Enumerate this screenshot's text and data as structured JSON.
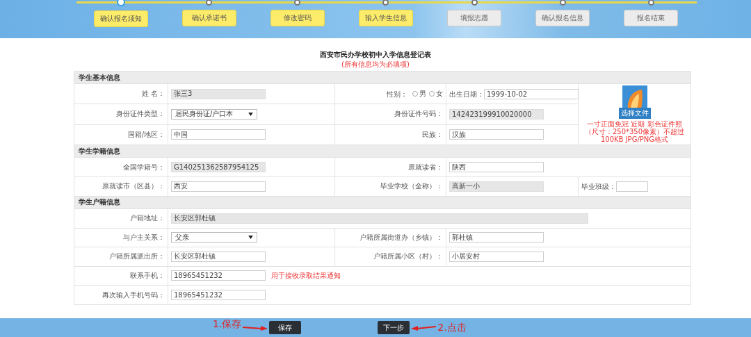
{
  "steps": [
    {
      "label": "确认报名须知",
      "done": true,
      "selected": true
    },
    {
      "label": "确认承诺书",
      "done": true,
      "selected": false
    },
    {
      "label": "修改密码",
      "done": true,
      "selected": false
    },
    {
      "label": "输入学生信息",
      "done": true,
      "selected": false
    },
    {
      "label": "填报志愿",
      "done": false,
      "selected": false
    },
    {
      "label": "确认报名信息",
      "done": false,
      "selected": false
    },
    {
      "label": "报名结束",
      "done": false,
      "selected": false
    }
  ],
  "form": {
    "title": "西安市民办学校初中入学信息登记表",
    "subtitle": "(所有信息均为必填项)",
    "sections": [
      {
        "title": "学生基本信息",
        "rows": [
          {
            "cells": [
              {
                "kind": "label",
                "text": "姓 名："
              },
              {
                "kind": "fields",
                "parts": [
                  {
                    "kind": "input",
                    "value": "张三3",
                    "readonly": true
                  }
                ]
              },
              {
                "kind": "label",
                "text": "性别：",
                "options": [
                  {
                    "label": "男",
                    "selected": false
                  },
                  {
                    "label": "女",
                    "selected": false
                  }
                ]
              },
              {
                "kind": "fields",
                "parts": [
                  {
                    "kind": "text",
                    "text": "出生日期："
                  },
                  {
                    "kind": "input",
                    "value": "1999-10-02",
                    "readonly": false
                  }
                ]
              },
              {
                "kind": "photo",
                "rowspan": 3,
                "button": "选择文件",
                "note": "一寸正面免冠 近期 彩色证件照（尺寸：250*350像素）不超过100KB JPG/PNG格式"
              }
            ]
          },
          {
            "cells": [
              {
                "kind": "label",
                "text": "身份证件类型："
              },
              {
                "kind": "fields",
                "parts": [
                  {
                    "kind": "select",
                    "value": "居民身份证/户口本"
                  }
                ]
              },
              {
                "kind": "label",
                "text": "身份证件号码："
              },
              {
                "kind": "fields",
                "parts": [
                  {
                    "kind": "input",
                    "value": "142423199910020000",
                    "readonly": true
                  }
                ]
              }
            ]
          },
          {
            "cells": [
              {
                "kind": "label",
                "text": "国籍/地区："
              },
              {
                "kind": "fields",
                "parts": [
                  {
                    "kind": "input",
                    "value": "中国",
                    "readonly": false
                  }
                ]
              },
              {
                "kind": "label",
                "text": "民族："
              },
              {
                "kind": "fields",
                "parts": [
                  {
                    "kind": "input",
                    "value": "汉族",
                    "readonly": false
                  }
                ]
              }
            ]
          }
        ]
      },
      {
        "title": "学生学籍信息",
        "rows": [
          {
            "cells": [
              {
                "kind": "label",
                "text": "全国学籍号："
              },
              {
                "kind": "fields",
                "parts": [
                  {
                    "kind": "input",
                    "value": "G140251362587954125",
                    "readonly": true
                  }
                ]
              },
              {
                "kind": "label",
                "text": "原就读省："
              },
              {
                "kind": "fields",
                "colspan": 2,
                "parts": [
                  {
                    "kind": "input",
                    "value": "陕西",
                    "readonly": false
                  }
                ]
              }
            ]
          },
          {
            "cells": [
              {
                "kind": "label",
                "text": "原就读市（区县）："
              },
              {
                "kind": "fields",
                "parts": [
                  {
                    "kind": "input",
                    "value": "西安",
                    "readonly": false
                  }
                ]
              },
              {
                "kind": "label",
                "text": "毕业学校（全称）："
              },
              {
                "kind": "fields",
                "parts": [
                  {
                    "kind": "input",
                    "value": "高新一小",
                    "readonly": true
                  }
                ]
              },
              {
                "kind": "fields",
                "parts": [
                  {
                    "kind": "text",
                    "text": "毕业班级："
                  },
                  {
                    "kind": "short-input",
                    "readonly": false
                  }
                ]
              }
            ]
          }
        ]
      },
      {
        "title": "学生户籍信息",
        "rows": [
          {
            "cells": [
              {
                "kind": "label",
                "text": "户籍地址："
              },
              {
                "kind": "fields",
                "colspan": 4,
                "parts": [
                  {
                    "kind": "long-input",
                    "value": "长安区郭杜镇",
                    "readonly": true
                  }
                ]
              }
            ]
          },
          {
            "cells": [
              {
                "kind": "label",
                "text": "与户主关系："
              },
              {
                "kind": "fields",
                "parts": [
                  {
                    "kind": "select",
                    "value": "父亲"
                  }
                ]
              },
              {
                "kind": "label",
                "text": "户籍所属街道办（乡镇）："
              },
              {
                "kind": "fields",
                "colspan": 2,
                "parts": [
                  {
                    "kind": "input",
                    "value": "郭杜镇",
                    "readonly": false
                  }
                ]
              }
            ]
          },
          {
            "cells": [
              {
                "kind": "label",
                "text": "户籍所属派出所："
              },
              {
                "kind": "fields",
                "parts": [
                  {
                    "kind": "input",
                    "value": "长安区郭杜镇",
                    "readonly": false
                  }
                ]
              },
              {
                "kind": "label",
                "text": "户籍所属小区（村）："
              },
              {
                "kind": "fields",
                "colspan": 2,
                "parts": [
                  {
                    "kind": "input",
                    "value": "小居安村",
                    "readonly": false
                  }
                ]
              }
            ]
          },
          {
            "cells": [
              {
                "kind": "label",
                "text": "联系手机："
              },
              {
                "kind": "fields",
                "colspan": 4,
                "parts": [
                  {
                    "kind": "input",
                    "value": "18965451232",
                    "readonly": false
                  },
                  {
                    "kind": "note",
                    "text": "用于接收录取结果通知"
                  }
                ]
              }
            ]
          },
          {
            "cells": [
              {
                "kind": "label",
                "text": "再次输入手机号码："
              },
              {
                "kind": "fields",
                "colspan": 4,
                "parts": [
                  {
                    "kind": "input",
                    "value": "18965451232",
                    "readonly": false
                  }
                ]
              }
            ]
          }
        ]
      }
    ]
  },
  "buttons": [
    {
      "label": "保存"
    },
    {
      "label": "下一步"
    }
  ],
  "annotations": [
    {
      "text": "1.保存"
    },
    {
      "text": "2.点击"
    }
  ]
}
